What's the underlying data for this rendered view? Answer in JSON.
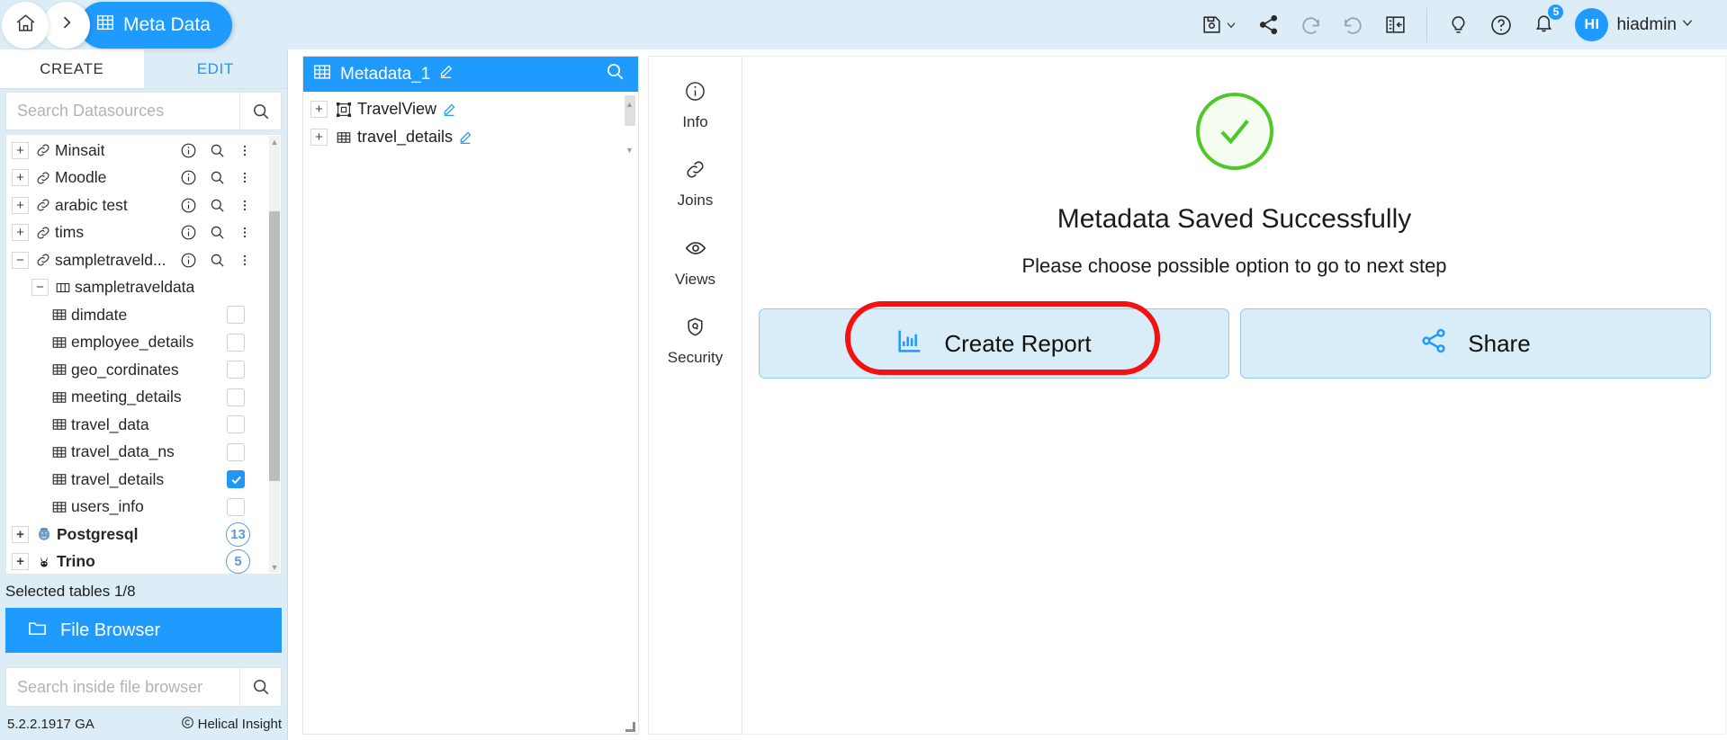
{
  "header": {
    "breadcrumb": {
      "home_icon": "home-icon",
      "chevron_icon": "chevron-right-icon",
      "current": "Meta Data",
      "current_icon": "table-icon"
    },
    "tools": [
      {
        "name": "save-icon",
        "label": "Save"
      },
      {
        "name": "share-icon",
        "label": "Share"
      },
      {
        "name": "undo-icon",
        "label": "Undo"
      },
      {
        "name": "redo-icon",
        "label": "Redo"
      },
      {
        "name": "collapse-panel-icon",
        "label": "Collapse Panel"
      }
    ],
    "help_tools": [
      {
        "name": "lightbulb-icon",
        "label": "Tips"
      },
      {
        "name": "help-icon",
        "label": "Help"
      }
    ],
    "notifications": {
      "icon": "bell-icon",
      "count": "5"
    },
    "user": {
      "initials": "HI",
      "name": "hiadmin",
      "chevron": "∨"
    },
    "accent": "#1f9bff",
    "bg": "#dcedf7"
  },
  "sidebar": {
    "tabs": [
      {
        "label": "CREATE",
        "active": true
      },
      {
        "label": "EDIT",
        "active": false
      }
    ],
    "search": {
      "placeholder": "Search Datasources",
      "value": "",
      "icon": "search-icon"
    },
    "tree": [
      {
        "kind": "datasource",
        "expander": "+",
        "icon": "link-icon",
        "label": "Minsait",
        "indent": 0
      },
      {
        "kind": "datasource",
        "expander": "+",
        "icon": "link-icon",
        "label": "Moodle",
        "indent": 0
      },
      {
        "kind": "datasource",
        "expander": "+",
        "icon": "link-icon",
        "label": "arabic test",
        "indent": 0
      },
      {
        "kind": "datasource",
        "expander": "+",
        "icon": "link-icon",
        "label": "tims",
        "indent": 0
      },
      {
        "kind": "datasource",
        "expander": "−",
        "icon": "link-icon",
        "label": "sampletraveld...",
        "indent": 0
      },
      {
        "kind": "schema",
        "expander": "−",
        "icon": "columns-icon",
        "label": "sampletraveldata",
        "indent": 1
      },
      {
        "kind": "table",
        "icon": "table-icon",
        "label": "dimdate",
        "indent": 2,
        "checked": false
      },
      {
        "kind": "table",
        "icon": "table-icon",
        "label": "employee_details",
        "indent": 2,
        "checked": false
      },
      {
        "kind": "table",
        "icon": "table-icon",
        "label": "geo_cordinates",
        "indent": 2,
        "checked": false
      },
      {
        "kind": "table",
        "icon": "table-icon",
        "label": "meeting_details",
        "indent": 2,
        "checked": false
      },
      {
        "kind": "table",
        "icon": "table-icon",
        "label": "travel_data",
        "indent": 2,
        "checked": false
      },
      {
        "kind": "table",
        "icon": "table-icon",
        "label": "travel_data_ns",
        "indent": 2,
        "checked": false
      },
      {
        "kind": "table",
        "icon": "table-icon",
        "label": "travel_details",
        "indent": 2,
        "checked": true
      },
      {
        "kind": "table",
        "icon": "table-icon",
        "label": "users_info",
        "indent": 2,
        "checked": false
      },
      {
        "kind": "db",
        "expander": "+",
        "icon": "postgresql-icon",
        "label": "Postgresql",
        "indent": 0,
        "badge": "13"
      },
      {
        "kind": "db",
        "expander": "+",
        "icon": "trino-icon",
        "label": "Trino",
        "indent": 0,
        "badge": "5"
      }
    ],
    "row_icons": {
      "info": "info-icon",
      "search": "search-icon",
      "more": "kebab-menu-icon"
    },
    "selected_tables": "Selected tables 1/8",
    "file_browser": {
      "label": "File Browser",
      "icon": "folder-icon"
    },
    "fb_search": {
      "placeholder": "Search inside file browser",
      "value": "",
      "icon": "search-icon"
    },
    "footer": {
      "version": "5.2.2.1917 GA",
      "copyright": "©",
      "brand": "Helical Insight"
    }
  },
  "metadata_panel": {
    "title": "Metadata_1",
    "title_icon": "table-icon",
    "edit_icon": "pencil-icon",
    "search_icon": "search-icon",
    "items": [
      {
        "expander": "+",
        "icon": "view-icon",
        "label": "TravelView",
        "edit_icon": "pencil-icon"
      },
      {
        "expander": "+",
        "icon": "table-icon",
        "label": "travel_details",
        "edit_icon": "pencil-icon"
      }
    ]
  },
  "vnav": [
    {
      "label": "Info",
      "icon": "info-icon",
      "active": false
    },
    {
      "label": "Joins",
      "icon": "link-icon",
      "active": false
    },
    {
      "label": "Views",
      "icon": "eye-icon",
      "active": false
    },
    {
      "label": "Security",
      "icon": "shield-lock-icon",
      "active": false
    }
  ],
  "main": {
    "status_icon": "success-check-icon",
    "status_color": "#4dc72a",
    "title": "Metadata Saved Successfully",
    "subtitle": "Please choose possible option to go to next step",
    "options": [
      {
        "label": "Create Report",
        "icon": "bar-chart-icon",
        "highlighted": true
      },
      {
        "label": "Share",
        "icon": "share-icon",
        "highlighted": false
      }
    ],
    "highlight_color": "#f31111"
  }
}
